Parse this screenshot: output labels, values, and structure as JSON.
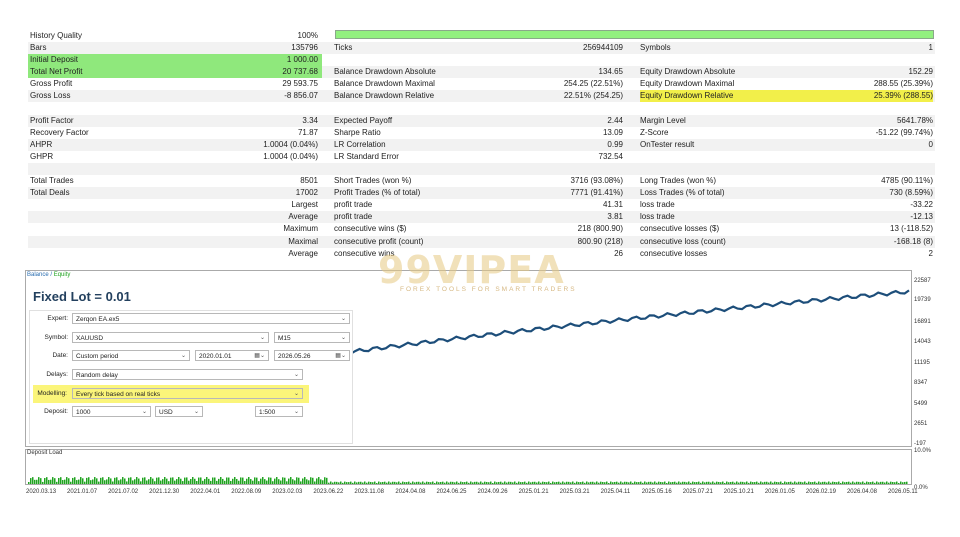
{
  "report": {
    "rows": [
      {
        "l1": "History Quality",
        "v1": "100%",
        "l2": "",
        "v2": "",
        "l3": "",
        "v3": ""
      },
      {
        "l1": "Bars",
        "v1": "135796",
        "l2": "Ticks",
        "v2": "256944109",
        "l3": "Symbols",
        "v3": "1"
      },
      {
        "l1": "Initial Deposit",
        "v1": "1 000.00",
        "l2": "",
        "v2": "",
        "l3": "",
        "v3": ""
      },
      {
        "l1": "Total Net Profit",
        "v1": "20 737.68",
        "l2": "Balance Drawdown Absolute",
        "v2": "134.65",
        "l3": "Equity Drawdown Absolute",
        "v3": "152.29"
      },
      {
        "l1": "Gross Profit",
        "v1": "29 593.75",
        "l2": "Balance Drawdown Maximal",
        "v2": "254.25 (22.51%)",
        "l3": "Equity Drawdown Maximal",
        "v3": "288.55 (25.39%)"
      },
      {
        "l1": "Gross Loss",
        "v1": "-8 856.07",
        "l2": "Balance Drawdown Relative",
        "v2": "22.51% (254.25)",
        "l3": "Equity Drawdown Relative",
        "v3": "25.39% (288.55)"
      },
      {
        "l1": "",
        "v1": "",
        "l2": "",
        "v2": "",
        "l3": "",
        "v3": ""
      },
      {
        "l1": "Profit Factor",
        "v1": "3.34",
        "l2": "Expected Payoff",
        "v2": "2.44",
        "l3": "Margin Level",
        "v3": "5641.78%"
      },
      {
        "l1": "Recovery Factor",
        "v1": "71.87",
        "l2": "Sharpe Ratio",
        "v2": "13.09",
        "l3": "Z-Score",
        "v3": "-51.22 (99.74%)"
      },
      {
        "l1": "AHPR",
        "v1": "1.0004 (0.04%)",
        "l2": "LR Correlation",
        "v2": "0.99",
        "l3": "OnTester result",
        "v3": "0"
      },
      {
        "l1": "GHPR",
        "v1": "1.0004 (0.04%)",
        "l2": "LR Standard Error",
        "v2": "732.54",
        "l3": "",
        "v3": ""
      },
      {
        "l1": "",
        "v1": "",
        "l2": "",
        "v2": "",
        "l3": "",
        "v3": ""
      },
      {
        "l1": "Total Trades",
        "v1": "8501",
        "l2": "Short Trades (won %)",
        "v2": "3716 (93.08%)",
        "l3": "Long Trades (won %)",
        "v3": "4785 (90.11%)"
      },
      {
        "l1": "Total Deals",
        "v1": "17002",
        "l2": "Profit Trades (% of total)",
        "v2": "7771 (91.41%)",
        "l3": "Loss Trades (% of total)",
        "v3": "730 (8.59%)"
      },
      {
        "l1": "",
        "v1": "Largest",
        "l2": "profit trade",
        "v2": "41.31",
        "l3": "loss trade",
        "v3": "-33.22"
      },
      {
        "l1": "",
        "v1": "Average",
        "l2": "profit trade",
        "v2": "3.81",
        "l3": "loss trade",
        "v3": "-12.13"
      },
      {
        "l1": "",
        "v1": "Maximum",
        "l2": "consecutive wins ($)",
        "v2": "218 (800.90)",
        "l3": "consecutive losses ($)",
        "v3": "13 (-118.52)"
      },
      {
        "l1": "",
        "v1": "Maximal",
        "l2": "consecutive profit (count)",
        "v2": "800.90 (218)",
        "l3": "consecutive loss (count)",
        "v3": "-168.18 (8)"
      },
      {
        "l1": "",
        "v1": "Average",
        "l2": "consecutive wins",
        "v2": "26",
        "l3": "consecutive losses",
        "v3": "2"
      }
    ]
  },
  "chart": {
    "title_balance": "Balance",
    "title_sep": " / ",
    "title_equity": "Equity",
    "y_ticks": [
      "22587",
      "19739",
      "16891",
      "14043",
      "11195",
      "8347",
      "5499",
      "2651",
      "-197"
    ],
    "load_title": "Deposit Load",
    "load_ticks": [
      "10.0%",
      "0.0%"
    ],
    "x_ticks": [
      "2020.03.13",
      "2021.01.07",
      "2021.07.02",
      "2021.12.30",
      "2022.04.01",
      "2022.08.09",
      "2023.02.03",
      "2023.06.22",
      "2023.11.08",
      "2024.04.08",
      "2024.06.25",
      "2024.09.26",
      "2025.01.21",
      "2025.03.21",
      "2025.04.11",
      "2025.05.16",
      "2025.07.21",
      "2025.10.21",
      "2026.01.05",
      "2026.02.19",
      "2026.04.08",
      "2026.05.11"
    ],
    "colors": {
      "line": "#1d4e7a",
      "load": "#1fa31f"
    }
  },
  "settings": {
    "lot_title": "Fixed Lot = 0.01",
    "expert_label": "Expert:",
    "expert_value": "Zerqon EA.ex5",
    "symbol_label": "Symbol:",
    "symbol_value": "XAUUSD",
    "timeframe_value": "M15",
    "date_label": "Date:",
    "date_mode": "Custom period",
    "date_from": "2020.01.01",
    "date_to": "2026.05.26",
    "delays_label": "Delays:",
    "delays_value": "Random delay",
    "modelling_label": "Modelling:",
    "modelling_value": "Every tick based on real ticks",
    "deposit_label": "Deposit:",
    "deposit_value": "1000",
    "currency_value": "USD",
    "leverage_value": "1:500"
  },
  "watermark": {
    "main": "99VIPEA",
    "sub": "FOREX TOOLS FOR SMART TRADERS"
  }
}
